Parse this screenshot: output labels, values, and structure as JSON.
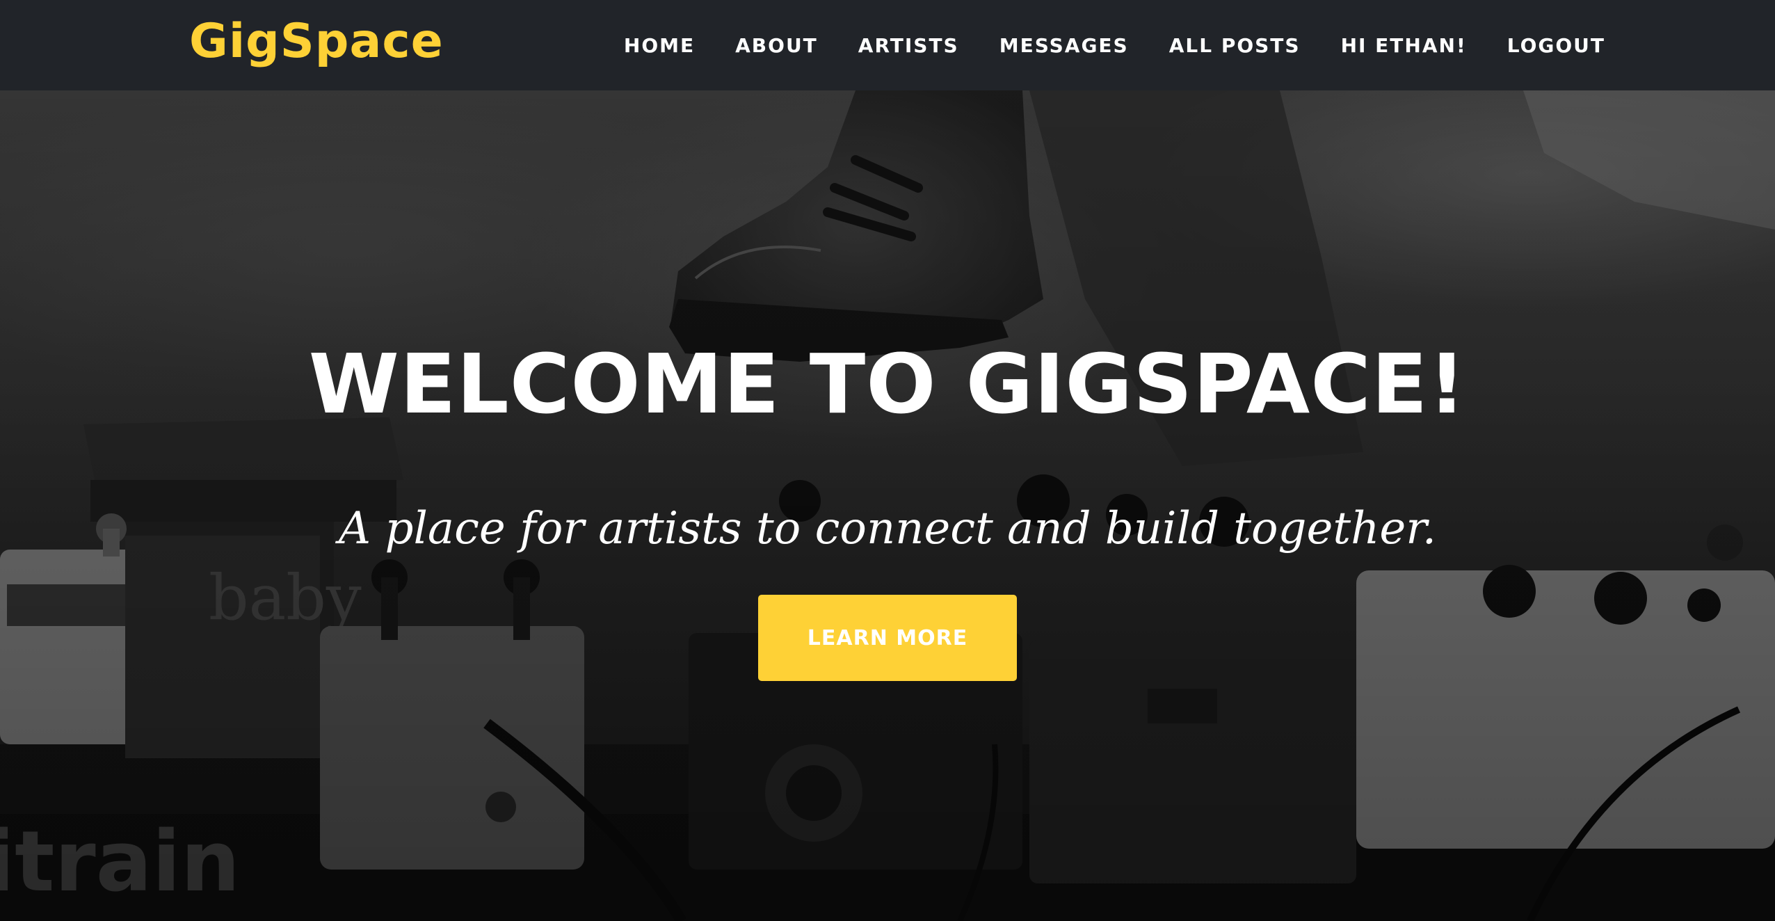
{
  "brand": {
    "name": "GigSpace",
    "color": "#fed136"
  },
  "nav": {
    "items": [
      {
        "label": "HOME"
      },
      {
        "label": "ABOUT"
      },
      {
        "label": "ARTISTS"
      },
      {
        "label": "MESSAGES"
      },
      {
        "label": "ALL POSTS"
      },
      {
        "label": "HI ETHAN!"
      },
      {
        "label": "LOGOUT"
      }
    ]
  },
  "hero": {
    "heading": "WELCOME TO GIGSPACE!",
    "subheading": "A place for artists to connect and build together.",
    "cta_label": "LEARN MORE",
    "background_image": "black-and-white photo of a sneaker above a guitar effects pedalboard",
    "pedal_brand_text": "baby",
    "board_brand_text": "itrain"
  },
  "colors": {
    "navbar_bg": "#212429",
    "accent": "#fed136",
    "text": "#ffffff"
  }
}
